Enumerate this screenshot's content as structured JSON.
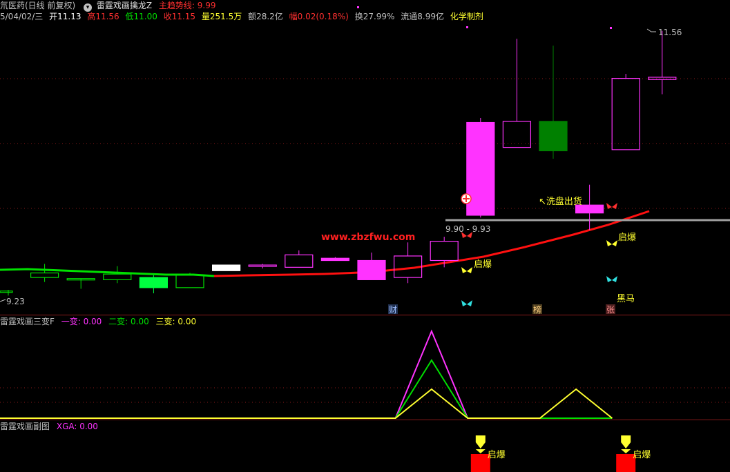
{
  "header": {
    "row1": {
      "stock_label": "氘医药(日线 前复权)",
      "indicator_icon": "circle-chevron-icon",
      "indicator_name": "雷霆戏画擒龙Z",
      "trend_label": "主趋势线: 9.99"
    },
    "row2": {
      "date": "5/04/02/三",
      "open": "开11.13",
      "high": "高11.56",
      "low": "低11.00",
      "close": "收11.15",
      "volume": "量251.5万",
      "amount": "额28.2亿",
      "change": "幅0.02(0.18%)",
      "turnover": "换27.99%",
      "float": "流通8.99亿",
      "sector": "化学制剂"
    }
  },
  "colors": {
    "background": "#000000",
    "panel_line": "#8b1a1a",
    "grid": "#8b1a1a",
    "up_candle": "#ff33ff",
    "down_solid": "#00ff40",
    "down_green": "#008000",
    "ma_green": "#00e000",
    "ma_red": "#ff1010",
    "gray_line": "#a0a0a0",
    "yellow": "#ffff30",
    "watermark": "#ff2020"
  },
  "chart_data": [
    {
      "type": "candlestick",
      "panel": "main",
      "ylim": [
        9.1,
        11.65
      ],
      "candles": [
        {
          "o": 9.26,
          "h": 9.27,
          "l": 9.22,
          "c": 9.26,
          "style": "down-hollow-green"
        },
        {
          "o": 9.42,
          "h": 9.5,
          "l": 9.34,
          "c": 9.38,
          "style": "down-hollow-green"
        },
        {
          "o": 9.37,
          "h": 9.37,
          "l": 9.28,
          "c": 9.37,
          "style": "down-hollow-green"
        },
        {
          "o": 9.41,
          "h": 9.48,
          "l": 9.33,
          "c": 9.36,
          "style": "down-hollow-green"
        },
        {
          "o": 9.38,
          "h": 9.4,
          "l": 9.24,
          "c": 9.29,
          "style": "down-solid-green"
        },
        {
          "o": 9.4,
          "h": 9.42,
          "l": 9.29,
          "c": 9.29,
          "style": "down-hollow-green"
        },
        {
          "o": 9.44,
          "h": 9.49,
          "l": 9.44,
          "c": 9.49,
          "style": "flat-white"
        },
        {
          "o": 9.49,
          "h": 9.5,
          "l": 9.46,
          "c": 9.48,
          "style": "up-hollow"
        },
        {
          "o": 9.47,
          "h": 9.62,
          "l": 9.47,
          "c": 9.58,
          "style": "up-hollow"
        },
        {
          "o": 9.53,
          "h": 9.56,
          "l": 9.53,
          "c": 9.55,
          "style": "up-solid"
        },
        {
          "o": 9.36,
          "h": 9.6,
          "l": 9.36,
          "c": 9.53,
          "style": "up-solid"
        },
        {
          "o": 9.38,
          "h": 9.69,
          "l": 9.33,
          "c": 9.57,
          "style": "up-hollow"
        },
        {
          "o": 9.53,
          "h": 9.74,
          "l": 9.47,
          "c": 9.7,
          "style": "up-hollow"
        },
        {
          "o": 9.93,
          "h": 10.79,
          "l": 9.91,
          "c": 10.75,
          "style": "up-solid"
        },
        {
          "o": 10.53,
          "h": 11.49,
          "l": 10.53,
          "c": 10.76,
          "style": "up-hollow"
        },
        {
          "o": 10.76,
          "h": 11.43,
          "l": 10.43,
          "c": 10.5,
          "style": "down-solid-darkgreen"
        },
        {
          "o": 9.95,
          "h": 10.2,
          "l": 9.8,
          "c": 10.02,
          "style": "up-solid"
        },
        {
          "o": 10.51,
          "h": 11.18,
          "l": 10.51,
          "c": 11.14,
          "style": "up-hollow"
        },
        {
          "o": 11.13,
          "h": 11.56,
          "l": 11.0,
          "c": 11.15,
          "style": "up-hollow"
        }
      ],
      "price_labels": {
        "high_marker": "11.56",
        "low_marker": "9.23",
        "range_label": "9.90 - 9.93"
      },
      "annotations": {
        "wash_out": "↖洗盘出货",
        "breakout1": "启爆",
        "breakout2": "启爆",
        "dark_horse": "黑马",
        "tag_cai": "财",
        "tag_bang": "榜",
        "tag_zhang": "张"
      },
      "watermark": "www.zbzfwu.com"
    },
    {
      "type": "line",
      "panel": "middle",
      "title": "雷霆戏画三变F",
      "legend": [
        {
          "name": "一变: 0.00",
          "color": "#ff33ff"
        },
        {
          "name": "二变: 0.00",
          "color": "#00e000"
        },
        {
          "name": "三变: 0.00",
          "color": "#ffff30"
        }
      ],
      "ylim": [
        0,
        3
      ],
      "series": [
        {
          "name": "一变",
          "values": [
            0,
            0,
            0,
            0,
            0,
            0,
            0,
            0,
            0,
            0,
            0,
            0,
            0,
            3,
            0,
            0,
            0,
            0,
            0
          ]
        },
        {
          "name": "二变",
          "values": [
            0,
            0,
            0,
            0,
            0,
            0,
            0,
            0,
            0,
            0,
            0,
            0,
            0,
            2,
            0,
            0,
            0,
            0,
            0
          ]
        },
        {
          "name": "三变",
          "values": [
            0,
            0,
            0,
            0,
            0,
            0,
            0,
            0,
            0,
            0,
            0,
            0,
            0,
            1,
            0,
            0,
            0,
            1,
            0
          ]
        }
      ]
    },
    {
      "type": "bar",
      "panel": "bottom",
      "title": "雷霆戏画副图",
      "legend": [
        {
          "name": "XGA: 0.00",
          "color": "#ff33ff"
        }
      ],
      "signals": [
        {
          "index": 13,
          "label": "启爆"
        },
        {
          "index": 17,
          "label": "启爆"
        }
      ]
    }
  ]
}
